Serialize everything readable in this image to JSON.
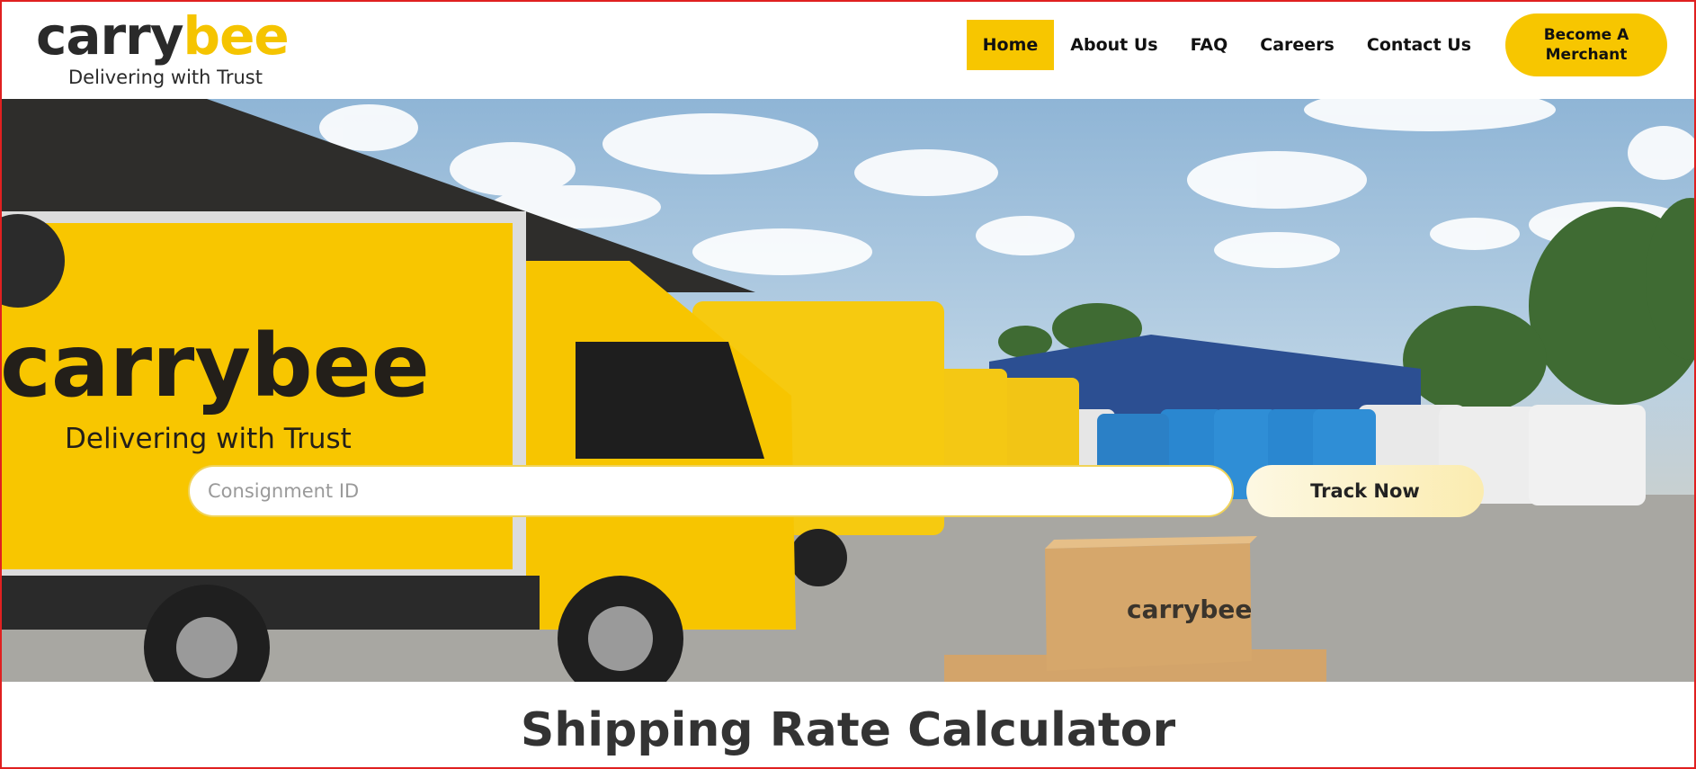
{
  "brand": {
    "name_part1": "carry",
    "name_part2": "bee",
    "tagline": "Delivering with Trust"
  },
  "nav": {
    "items": [
      {
        "label": "Home",
        "active": true
      },
      {
        "label": "About Us",
        "active": false
      },
      {
        "label": "FAQ",
        "active": false
      },
      {
        "label": "Careers",
        "active": false
      },
      {
        "label": "Contact Us",
        "active": false
      }
    ],
    "cta_label": "Become A Merchant"
  },
  "hero": {
    "truck_brand_part1": "carry",
    "truck_brand_part2": "bee",
    "truck_tagline": "Delivering with Trust",
    "box_brand": "carrybee",
    "tracking": {
      "placeholder": "Consignment ID",
      "value": "",
      "button_label": "Track Now"
    }
  },
  "section": {
    "title": "Shipping Rate Calculator"
  },
  "colors": {
    "brand_yellow": "#f7c600",
    "text_dark": "#111111",
    "frame_red": "#e02020"
  }
}
